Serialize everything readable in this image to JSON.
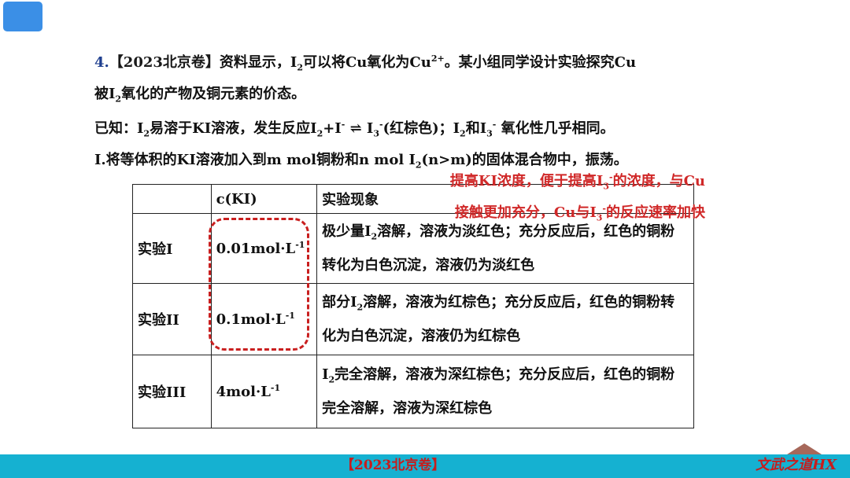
{
  "question": {
    "line1": {
      "num": "4.",
      "tag": "【2023北京卷】",
      "text_a": "资料显示，I",
      "sub_a": "2",
      "text_b": "可以将Cu氧化为Cu",
      "sup_b": "2+",
      "text_c": "。某小组同学设计实验探究Cu"
    },
    "line2": {
      "text_a": "被I",
      "sub_a": "2",
      "text_b": "氧化的产物及铜元素的价态。"
    },
    "line3": {
      "text_a": "已知：I",
      "sub_a": "2",
      "text_b": "易溶于KI溶液，发生反应I",
      "sub_b": "2",
      "text_c": "+I",
      "sup_c": "-",
      "text_d": " ⇌ I",
      "sub_d": "3",
      "sup_d": "-",
      "text_e": "(红棕色)；I",
      "sub_e": "2",
      "text_f": "和I",
      "sub_f": "3",
      "sup_f": "-",
      "text_g": " 氧化性几乎相同。"
    },
    "line4": {
      "text_a": "I.将等体积的KI溶液加入到m mol铜粉和n mol I",
      "sub_a": "2",
      "text_b": "(n>m)的固体混合物中，振荡。"
    }
  },
  "note": {
    "line1_a": "提高KI浓度，便于提高I",
    "line1_sub": "3",
    "line1_sup": "-",
    "line1_b": "的浓度，与Cu",
    "line2_a": "接触更加充分，Cu与I",
    "line2_sub": "3",
    "line2_sup": "-",
    "line2_b": "的反应速率加快"
  },
  "table": {
    "header": {
      "col1": "",
      "col2": "c(KI)",
      "col3": "实验现象"
    },
    "rows": [
      {
        "name": "实验I",
        "conc": "0.01mol·L",
        "conc_sup": "-1",
        "phen_a": "极少量I",
        "phen_sub": "2",
        "phen_b": "溶解，溶液为淡红色；充分反应后，红色的铜粉转化为白色沉淀，溶液仍为淡红色"
      },
      {
        "name": "实验II",
        "conc": "0.1mol·L",
        "conc_sup": "-1",
        "phen_a": "部分I",
        "phen_sub": "2",
        "phen_b": "溶解，溶液为红棕色；充分反应后，红色的铜粉转化为白色沉淀，溶液仍为红棕色"
      },
      {
        "name": "实验III",
        "conc": "4mol·L",
        "conc_sup": "-1",
        "phen_a": "I",
        "phen_sub": "2",
        "phen_b": "完全溶解，溶液为深红棕色；充分反应后，红色的铜粉完全溶解，溶液为深红棕色"
      }
    ]
  },
  "footer": {
    "label": "【2023北京卷】",
    "brand": "文武之道HX"
  },
  "colors": {
    "accent_blue": "#3b8fe6",
    "footer_bar": "#15b1d1",
    "annotation_red": "#d02828"
  }
}
